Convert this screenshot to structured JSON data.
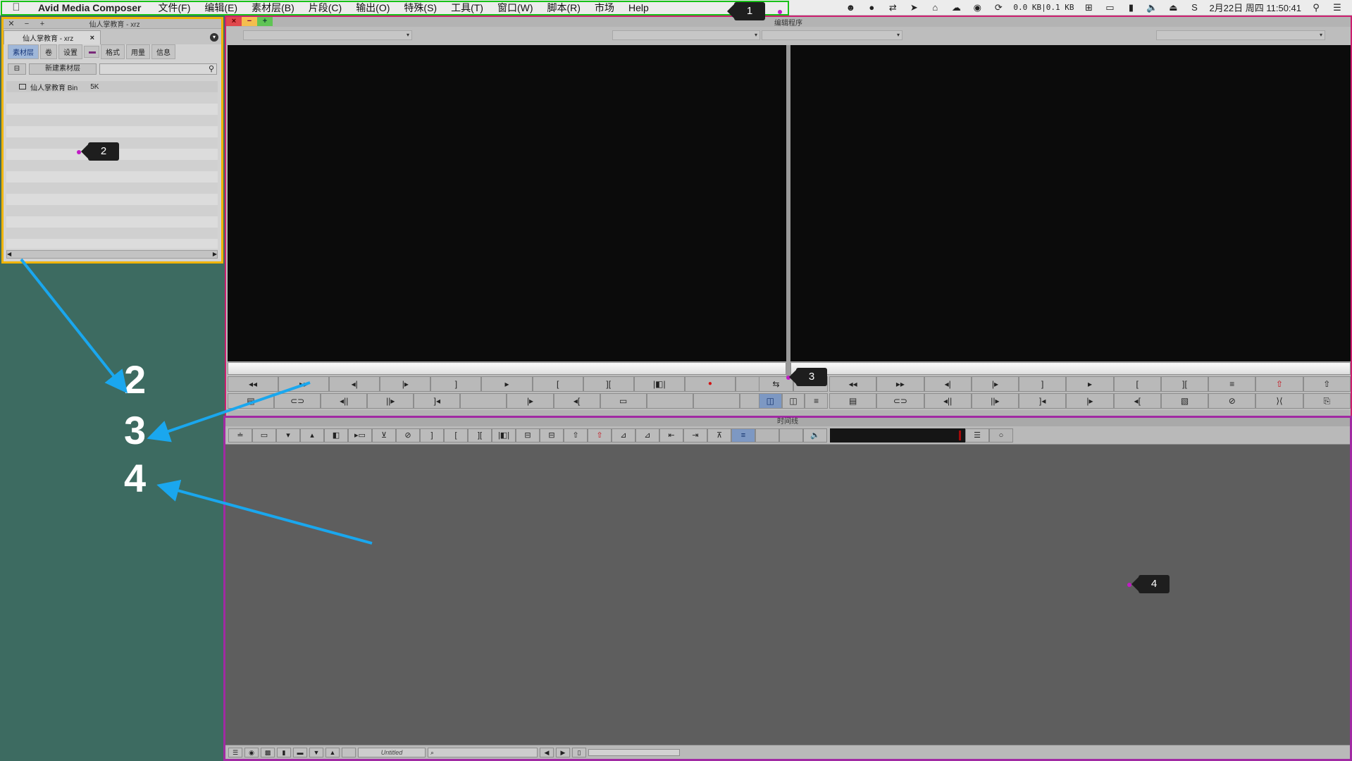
{
  "menubar": {
    "apple": "",
    "app_name": "Avid Media Composer",
    "items": [
      "文件(F)",
      "编辑(E)",
      "素材层(B)",
      "片段(C)",
      "输出(O)",
      "特殊(S)",
      "工具(T)",
      "窗口(W)",
      "脚本(R)",
      "市场",
      "Help"
    ],
    "status": {
      "net_rate": "0.0 KB|0.1 KB",
      "datetime": "2月22日 周四 11:50:41"
    }
  },
  "bin": {
    "window_title": "仙人掌教育 - xrz",
    "tab_label": "仙人掌教育 - xrz",
    "tab_close": "×",
    "view_tabs": [
      "素材层",
      "卷",
      "设置",
      "",
      "格式",
      "用量",
      "信息"
    ],
    "new_bin_label": "新建素材层",
    "rows": [
      {
        "name": "仙人掌教育 Bin",
        "size": "5K"
      }
    ]
  },
  "composer": {
    "title": "编辑程序",
    "source_buttons_row1": [
      "◂◂",
      "▸▸",
      "◂|",
      "|▸",
      "]",
      "▸",
      "[",
      "][",
      "|◧|",
      "●",
      ""
    ],
    "source_buttons_row2": [
      "▤",
      "⊂⊃",
      "◂||",
      "||▸",
      "]◂",
      "",
      "|▸",
      "◂[",
      "▭",
      "",
      "",
      ""
    ],
    "record_buttons_row1": [
      "◂◂",
      "▸▸",
      "◂|",
      "|▸",
      "]",
      "▸",
      "[",
      "][",
      "≡",
      "⇧",
      "⇧"
    ],
    "record_buttons_row2": [
      "▤",
      "⊂⊃",
      "◂||",
      "||▸",
      "]◂",
      "|▸",
      "◂[",
      "▧",
      "⊘",
      "⟩⟨",
      "⎘"
    ]
  },
  "timeline": {
    "title": "时间线",
    "toolbar": [
      "≐",
      "▭",
      "▾",
      "▴",
      "◧",
      "▸▭",
      "⊻",
      "⊘",
      "]",
      "[",
      "][",
      "|◧|",
      "⊟",
      "⊟",
      "⇧",
      "⇧",
      "⊿",
      "⊿",
      "⇤",
      "⇥",
      "⊼",
      "≡",
      "",
      ""
    ],
    "sequence_name": "Untitled",
    "find_placeholder": "⌕"
  },
  "annotations": {
    "callouts": [
      "1",
      "2",
      "3",
      "4"
    ],
    "big_labels": [
      "2",
      "3",
      "4"
    ]
  },
  "colors": {
    "highlight_menubar": "#17c117",
    "highlight_bin": "#f0b400",
    "highlight_composer": "#cc1f70",
    "highlight_timeline": "#a12aa3",
    "arrow": "#1aa7ee",
    "desktop": "#3d6b61"
  }
}
